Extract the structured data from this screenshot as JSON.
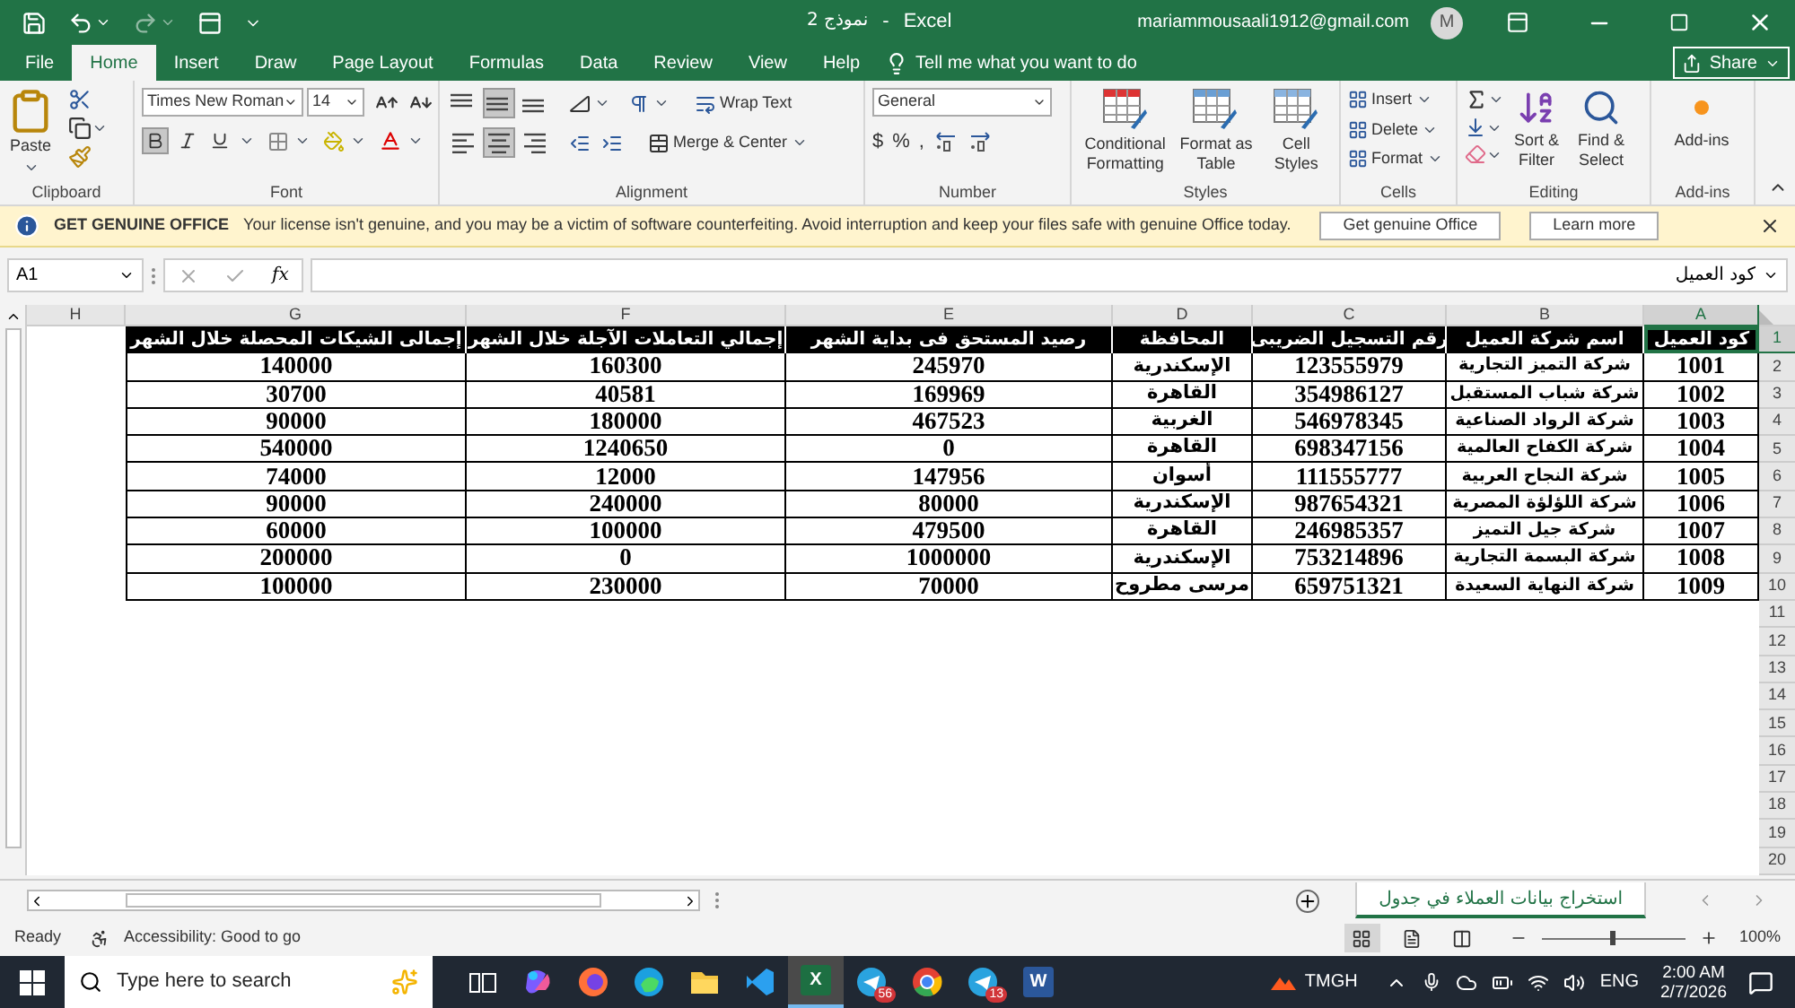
{
  "title_bar": {
    "document": "نموذج 2",
    "separator": "-",
    "app": "Excel",
    "account": "mariammousaali1912@gmail.com",
    "avatar": "M"
  },
  "menu_tabs": [
    {
      "label": "File",
      "selected": false
    },
    {
      "label": "Home",
      "selected": true
    },
    {
      "label": "Insert",
      "selected": false
    },
    {
      "label": "Draw",
      "selected": false
    },
    {
      "label": "Page Layout",
      "selected": false
    },
    {
      "label": "Formulas",
      "selected": false
    },
    {
      "label": "Data",
      "selected": false
    },
    {
      "label": "Review",
      "selected": false
    },
    {
      "label": "View",
      "selected": false
    },
    {
      "label": "Help",
      "selected": false
    }
  ],
  "tell_me": {
    "placeholder": "Tell me what you want to do"
  },
  "share_button": "Share",
  "ribbon": {
    "clipboard": {
      "label": "Clipboard",
      "paste": "Paste"
    },
    "font": {
      "label": "Font",
      "font_name": "Times New Roman",
      "font_size": "14",
      "bold": true,
      "italic": false,
      "underline": false
    },
    "alignment": {
      "label": "Alignment",
      "wrap_text": "Wrap Text",
      "merge_center": "Merge & Center",
      "vertical_align": [
        {
          "selected": false
        },
        {
          "selected": true
        },
        {
          "selected": false
        }
      ],
      "horizontal_align": [
        {
          "selected": false
        },
        {
          "selected": true
        },
        {
          "selected": false
        }
      ]
    },
    "number": {
      "label": "Number",
      "format": "General",
      "buttons": [
        "$",
        "%",
        ","
      ]
    },
    "styles": {
      "label": "Styles",
      "buttons": [
        "Conditional Formatting",
        "Format as Table",
        "Cell Styles"
      ]
    },
    "cells": {
      "label": "Cells",
      "buttons": [
        "Insert",
        "Delete",
        "Format"
      ]
    },
    "editing": {
      "label": "Editing",
      "buttons": [
        "Sort & Filter",
        "Find & Select"
      ]
    },
    "add_ins": {
      "label": "Add-ins",
      "button": "Add-ins"
    }
  },
  "info_bar": {
    "title": "GET GENUINE OFFICE",
    "message": "Your license isn't genuine, and you may be a victim of software counterfeiting. Avoid interruption and keep your files safe with genuine Office today.",
    "buttons": [
      "Get genuine Office",
      "Learn more"
    ]
  },
  "formula_bar": {
    "name_box": "A1",
    "function_label": "fx",
    "content": "كود العميل"
  },
  "sheet": {
    "column_letters": [
      {
        "letter": "H",
        "selected": false
      },
      {
        "letter": "G",
        "selected": false
      },
      {
        "letter": "F",
        "selected": false
      },
      {
        "letter": "E",
        "selected": false
      },
      {
        "letter": "D",
        "selected": false
      },
      {
        "letter": "C",
        "selected": false
      },
      {
        "letter": "B",
        "selected": false
      },
      {
        "letter": "A",
        "selected": true
      }
    ],
    "row_numbers": [
      {
        "number": "1",
        "selected": true
      },
      {
        "number": "2",
        "selected": false
      },
      {
        "number": "3",
        "selected": false
      },
      {
        "number": "4",
        "selected": false
      },
      {
        "number": "5",
        "selected": false
      },
      {
        "number": "6",
        "selected": false
      },
      {
        "number": "7",
        "selected": false
      },
      {
        "number": "8",
        "selected": false
      },
      {
        "number": "9",
        "selected": false
      },
      {
        "number": "10",
        "selected": false
      },
      {
        "number": "11",
        "selected": false
      },
      {
        "number": "12",
        "selected": false
      },
      {
        "number": "13",
        "selected": false
      },
      {
        "number": "14",
        "selected": false
      },
      {
        "number": "15",
        "selected": false
      },
      {
        "number": "16",
        "selected": false
      },
      {
        "number": "17",
        "selected": false
      },
      {
        "number": "18",
        "selected": false
      },
      {
        "number": "19",
        "selected": false
      },
      {
        "number": "20",
        "selected": false
      }
    ],
    "rows": [
      [
        "",
        "إجمالى الشيكات المحصلة خلال الشهر",
        "إجمالي التعاملات الآجلة خلال الشهر",
        "رصيد المستحق فى بداية الشهر",
        "المحافظة",
        "رقم التسجيل الضريبى",
        "اسم شركة العميل",
        "كود العميل"
      ],
      [
        "",
        "140000",
        "160300",
        "245970",
        "الإسكندرية",
        "123555979",
        "شركة التميز التجارية",
        "1001"
      ],
      [
        "",
        "30700",
        "40581",
        "169969",
        "القاهرة",
        "354986127",
        "شركة شباب المستقبل",
        "1002"
      ],
      [
        "",
        "90000",
        "180000",
        "467523",
        "الغربية",
        "546978345",
        "شركة الرواد الصناعية",
        "1003"
      ],
      [
        "",
        "540000",
        "1240650",
        "0",
        "القاهرة",
        "698347156",
        "شركة الكفاح العالمية",
        "1004"
      ],
      [
        "",
        "74000",
        "12000",
        "147956",
        "أسوان",
        "111555777",
        "شركة النجاح العربية",
        "1005"
      ],
      [
        "",
        "90000",
        "240000",
        "80000",
        "الإسكندرية",
        "987654321",
        "شركة اللؤلؤة المصرية",
        "1006"
      ],
      [
        "",
        "60000",
        "100000",
        "479500",
        "القاهرة",
        "246985357",
        "شركة جيل التميز",
        "1007"
      ],
      [
        "",
        "200000",
        "0",
        "1000000",
        "الإسكندرية",
        "753214896",
        "شركة البسمة التجارية",
        "1008"
      ],
      [
        "",
        "100000",
        "230000",
        "70000",
        "مرسى مطروح",
        "659751321",
        "شركة النهاية السعيدة",
        "1009"
      ]
    ]
  },
  "sheet_tabs": [
    {
      "label": "استخراج بيانات العملاء في جدول",
      "selected": true
    }
  ],
  "status_bar": {
    "status": "Ready",
    "accessibility": "Accessibility: Good to go",
    "views": [
      {
        "selected": true
      },
      {
        "selected": false
      },
      {
        "selected": false
      }
    ],
    "zoom": {
      "level": 0.5
    },
    "zoom_text": "100%"
  },
  "taskbar": {
    "search": {
      "placeholder": "Type here to search"
    },
    "apps": [
      {
        "kind": "task_view",
        "selected": false
      },
      {
        "kind": "copilot",
        "selected": false
      },
      {
        "kind": "firefox",
        "selected": false
      },
      {
        "kind": "edge",
        "selected": false
      },
      {
        "kind": "folder",
        "selected": false
      },
      {
        "kind": "vscode",
        "selected": false
      },
      {
        "kind": "excel",
        "selected": true,
        "glyph": "X"
      },
      {
        "kind": "telegram",
        "selected": false,
        "badge": "56"
      },
      {
        "kind": "chrome",
        "selected": false
      },
      {
        "kind": "telegram",
        "selected": false,
        "badge": "13"
      },
      {
        "kind": "word",
        "selected": false,
        "glyph": "W"
      }
    ],
    "weather": "TMGH",
    "language": "ENG",
    "time": "2:00 AM",
    "date": "2/7/2026"
  }
}
